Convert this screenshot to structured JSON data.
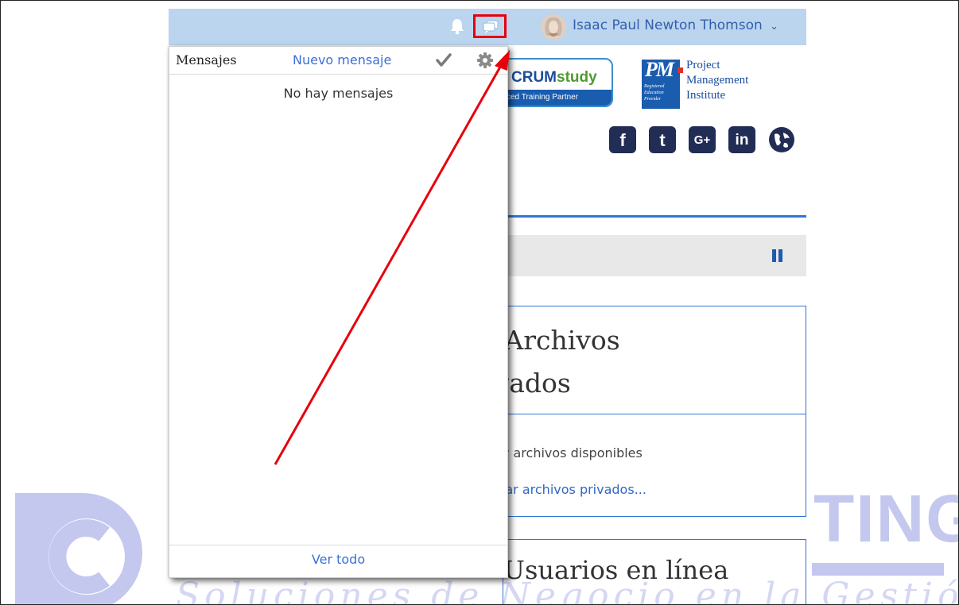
{
  "header": {
    "user_name": "Isaac Paul Newton Thomson",
    "dropdown_caret": "⌄"
  },
  "messages_popover": {
    "title": "Mensajes",
    "new_message_label": "Nuevo mensaje",
    "empty_text": "No hay mensajes",
    "view_all_label": "Ver todo"
  },
  "partner_logos": {
    "scrum_text_a": "CRUM",
    "scrum_text_b": "study",
    "scrum_tagline": "ced Training Partner",
    "pmi_mark": "PM",
    "pmi_small": "Registered Education Provider",
    "pmi_line1": "Project",
    "pmi_line2": "Management",
    "pmi_line3": "Institute"
  },
  "social_icons": [
    "facebook-icon",
    "twitter-icon",
    "google-plus-icon",
    "linkedin-icon",
    "globe-icon"
  ],
  "social_glyphs": {
    "facebook": "f",
    "twitter": "t",
    "google": "G+",
    "linkedin": "in"
  },
  "private_files": {
    "title_line1": ") Archivos",
    "title_line2": "ivados",
    "empty_text": "hay archivos disponibles",
    "manage_link": "ionar archivos privados..."
  },
  "online_users": {
    "title": "Usuarios en línea"
  },
  "watermark": {
    "suffix": "TING",
    "script": "Soluciones de Negocio en la Gestión de Pr"
  },
  "colors": {
    "navbar": "#bcd5ee",
    "highlight_box": "#e8000b",
    "arrow": "#e8000b",
    "link": "#3b6fd8",
    "accent": "#2f77d3"
  }
}
